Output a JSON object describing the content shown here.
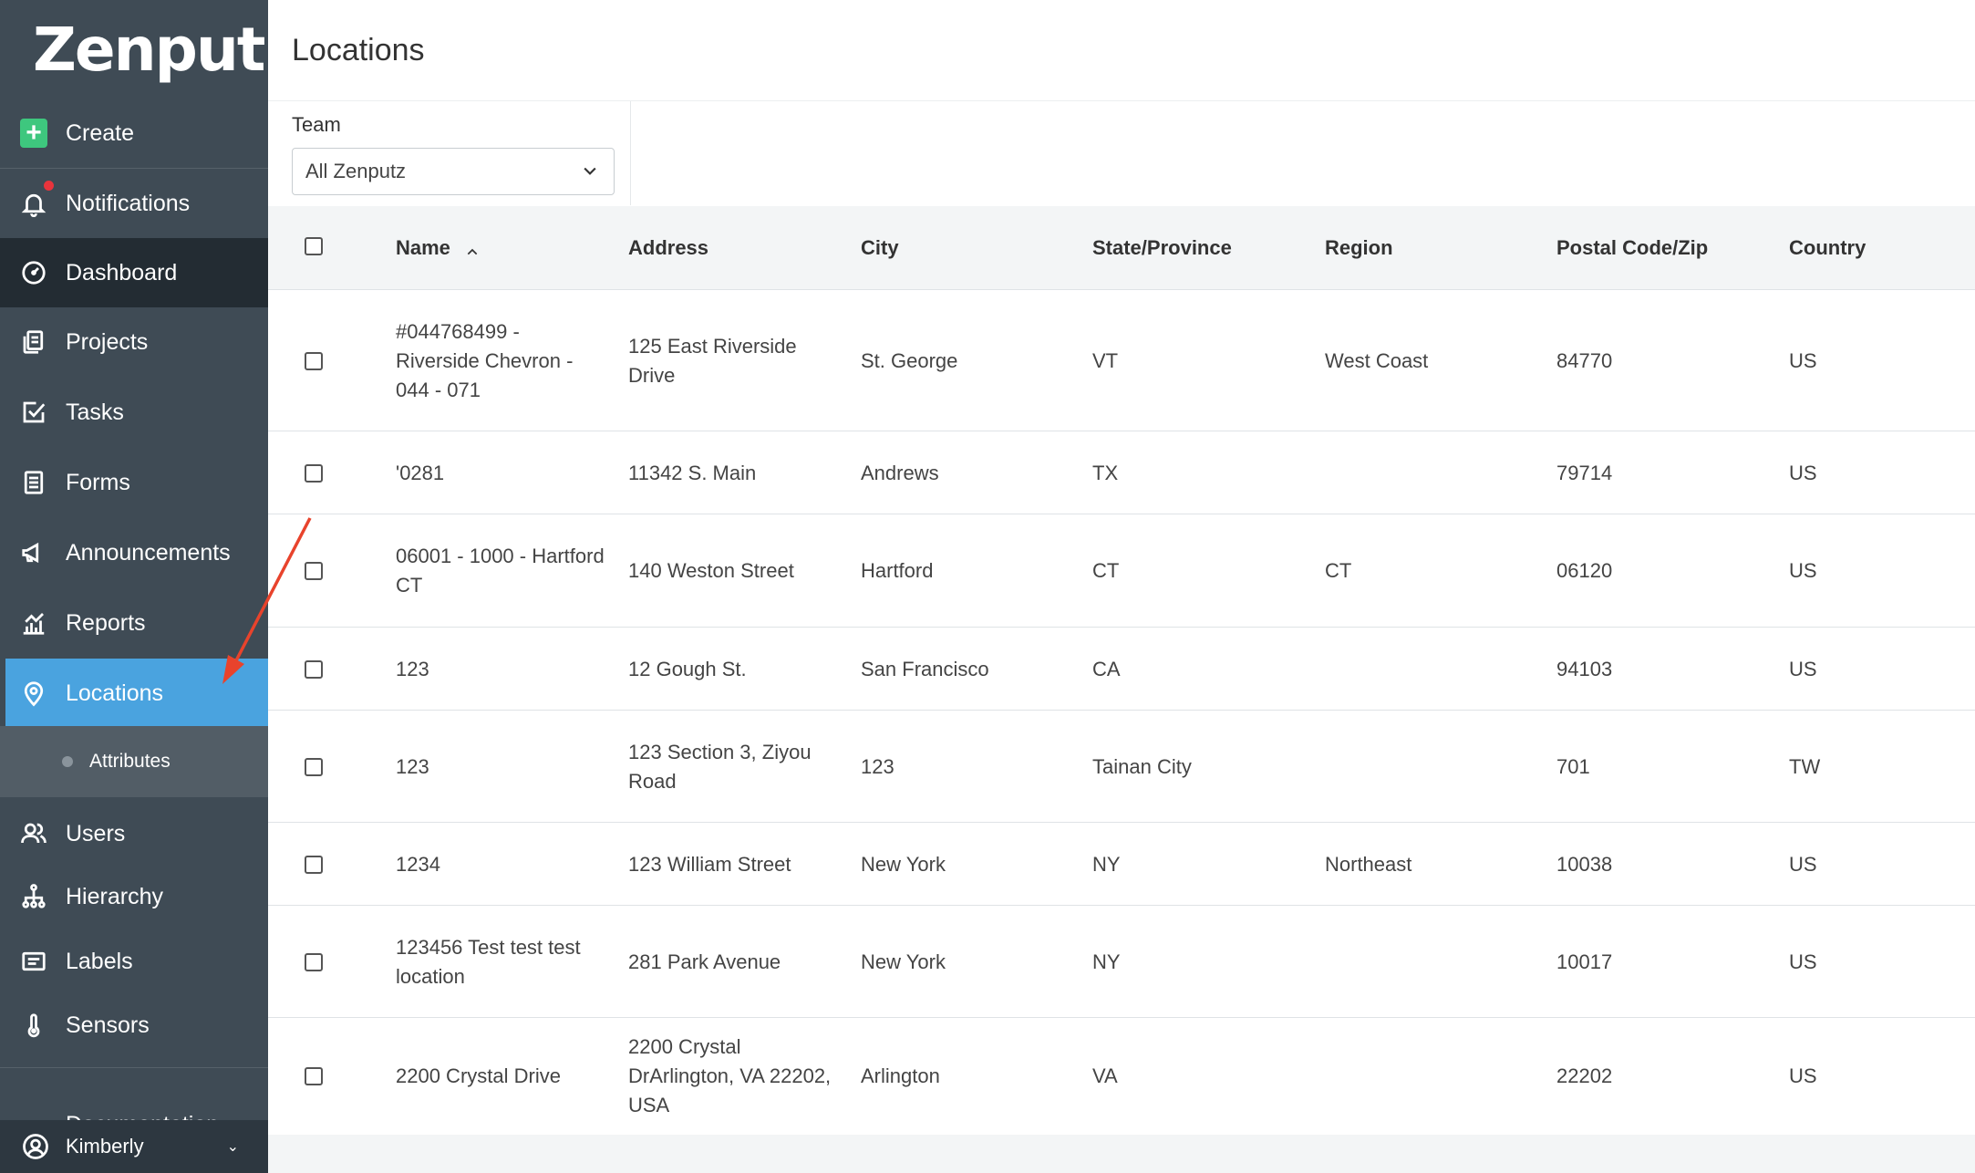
{
  "app": {
    "logo": "Zenput."
  },
  "sidebar": {
    "items": [
      {
        "label": "Create",
        "icon": "plus-icon"
      },
      {
        "label": "Notifications",
        "icon": "bell-icon"
      },
      {
        "label": "Dashboard",
        "icon": "gauge-icon"
      },
      {
        "label": "Projects",
        "icon": "projects-icon"
      },
      {
        "label": "Tasks",
        "icon": "checkbox-icon"
      },
      {
        "label": "Forms",
        "icon": "form-icon"
      },
      {
        "label": "Announcements",
        "icon": "megaphone-icon"
      },
      {
        "label": "Reports",
        "icon": "chart-icon"
      },
      {
        "label": "Locations",
        "icon": "map-pin-icon"
      },
      {
        "label": "Users",
        "icon": "users-icon"
      },
      {
        "label": "Hierarchy",
        "icon": "hierarchy-icon"
      },
      {
        "label": "Labels",
        "icon": "labels-icon"
      },
      {
        "label": "Sensors",
        "icon": "thermometer-icon"
      }
    ],
    "sub_item": "Attributes",
    "documentation_partial": "Documentation",
    "user_name": "Kimberly",
    "active": "Locations"
  },
  "page": {
    "title": "Locations"
  },
  "filter": {
    "team_label": "Team",
    "team_value": "All Zenputz"
  },
  "table": {
    "columns": [
      "Name",
      "Address",
      "City",
      "State/Province",
      "Region",
      "Postal Code/Zip",
      "Country"
    ],
    "rows": [
      {
        "name": "#044768499 - Riverside Chevron - 044 - 071",
        "address": "125 East Riverside Drive",
        "city": "St. George",
        "state": "VT",
        "region": "West Coast",
        "zip": "84770",
        "country": "US"
      },
      {
        "name": "'0281",
        "address": "11342 S. Main",
        "city": "Andrews",
        "state": "TX",
        "region": "",
        "zip": "79714",
        "country": "US"
      },
      {
        "name": "06001 - 1000 - Hartford CT",
        "address": "140 Weston Street",
        "city": "Hartford",
        "state": "CT",
        "region": "CT",
        "zip": "06120",
        "country": "US"
      },
      {
        "name": "123",
        "address": "12 Gough St.",
        "city": "San Francisco",
        "state": "CA",
        "region": "",
        "zip": "94103",
        "country": "US"
      },
      {
        "name": "123",
        "address": "123 Section 3, Ziyou Road",
        "city": "123",
        "state": "Tainan City",
        "region": "",
        "zip": "701",
        "country": "TW"
      },
      {
        "name": "1234",
        "address": "123 William Street",
        "city": "New York",
        "state": "NY",
        "region": "Northeast",
        "zip": "10038",
        "country": "US"
      },
      {
        "name": "123456 Test test test location",
        "address": "281 Park Avenue",
        "city": "New York",
        "state": "NY",
        "region": "",
        "zip": "10017",
        "country": "US"
      },
      {
        "name": "2200 Crystal Drive",
        "address": "2200 Crystal DrArlington, VA 22202, USA",
        "city": "Arlington",
        "state": "VA",
        "region": "",
        "zip": "22202",
        "country": "US"
      }
    ]
  },
  "colors": {
    "sidebar": "#3f4b55",
    "active": "#4aa3df",
    "dark_item": "#232c33",
    "create_green": "#3ec77e",
    "annotation_arrow": "#e8432c"
  }
}
